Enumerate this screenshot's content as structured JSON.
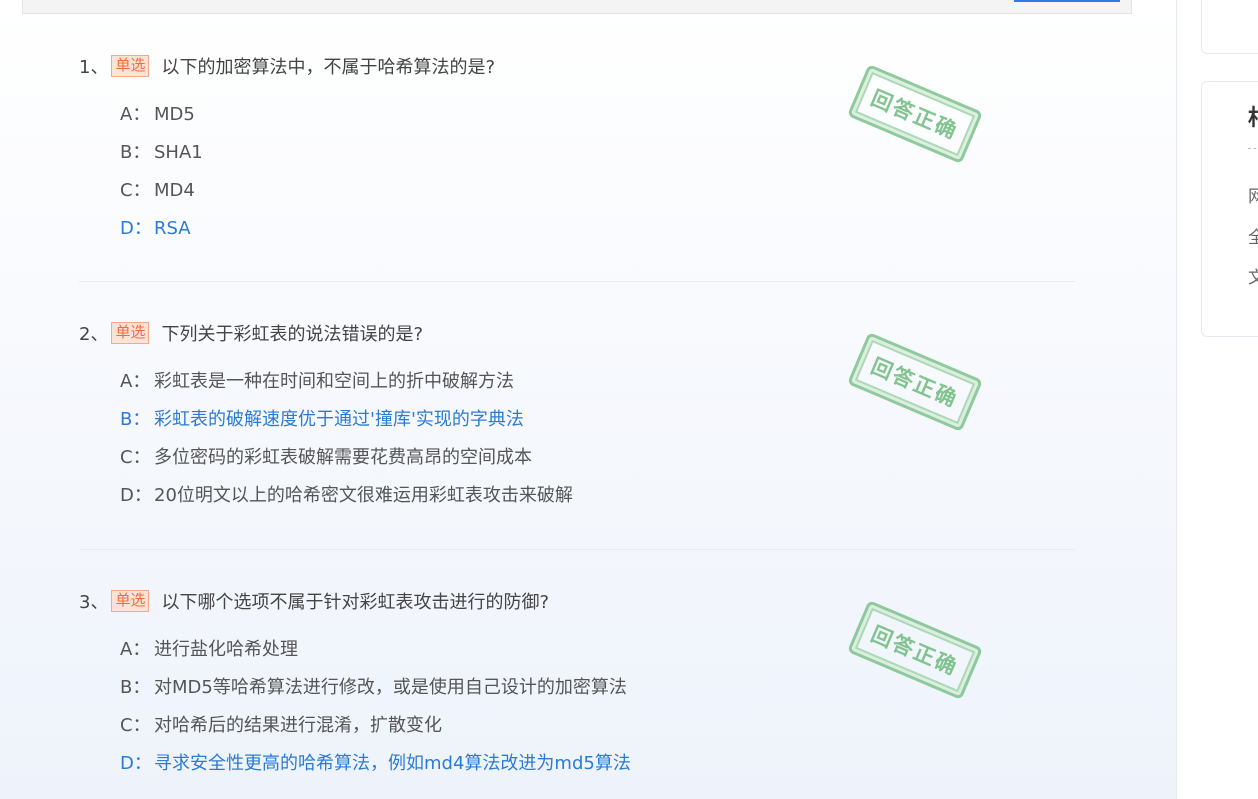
{
  "questions": [
    {
      "num": "1、",
      "tag": "单选",
      "text": "以下的加密算法中，不属于哈希算法的是?",
      "options": [
        {
          "letter": "A：",
          "text": "MD5"
        },
        {
          "letter": "B：",
          "text": "SHA1"
        },
        {
          "letter": "C：",
          "text": "MD4"
        },
        {
          "letter": "D：",
          "text": "RSA"
        }
      ],
      "correct": "D",
      "stamp": "回答正确"
    },
    {
      "num": "2、",
      "tag": "单选",
      "text": "下列关于彩虹表的说法错误的是?",
      "options": [
        {
          "letter": "A：",
          "text": "彩虹表是一种在时间和空间上的折中破解方法"
        },
        {
          "letter": "B：",
          "text": "彩虹表的破解速度优于通过'撞库'实现的字典法"
        },
        {
          "letter": "C：",
          "text": "多位密码的彩虹表破解需要花费高昂的空间成本"
        },
        {
          "letter": "D：",
          "text": "20位明文以上的哈希密文很难运用彩虹表攻击来破解"
        }
      ],
      "correct": "B",
      "stamp": "回答正确"
    },
    {
      "num": "3、",
      "tag": "单选",
      "text": "以下哪个选项不属于针对彩虹表攻击进行的防御?",
      "options": [
        {
          "letter": "A：",
          "text": "进行盐化哈希处理"
        },
        {
          "letter": "B：",
          "text": "对MD5等哈希算法进行修改，或是使用自己设计的加密算法"
        },
        {
          "letter": "C：",
          "text": "对哈希后的结果进行混淆，扩散变化"
        },
        {
          "letter": "D：",
          "text": "寻求安全性更高的哈希算法，例如md4算法改进为md5算法"
        }
      ],
      "correct": "D",
      "stamp": "回答正确"
    }
  ],
  "sidebar": {
    "title": "相",
    "items": [
      "网",
      "全",
      "文"
    ]
  },
  "colors": {
    "correct": "#2b7bd6",
    "tag": "#f26b3a",
    "stamp": "#6dbb7c"
  }
}
